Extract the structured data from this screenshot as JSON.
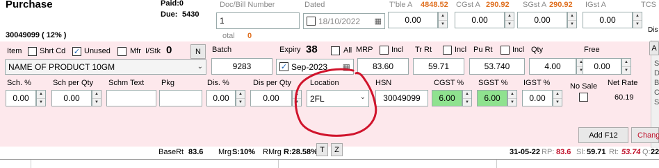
{
  "header": {
    "title": "Purchase",
    "paid_label": "Paid:0",
    "due_label": "Due:",
    "due_value": "5430",
    "invoice_ref": "30049099 ( 12% )",
    "total_label": "otal",
    "total_value": "0"
  },
  "doc": {
    "label": "Doc/Bill Number",
    "value": "1"
  },
  "dated": {
    "label": "Dated",
    "value": "18/10/2022"
  },
  "tax_summary": {
    "tble_label": "T'ble A",
    "tble_value": "4848.52",
    "cgst_label": "CGst A",
    "cgst_value": "290.92",
    "sgst_label": "SGst A",
    "sgst_value": "290.92",
    "igst_label": "IGst A",
    "igst_value": "",
    "tcs_label": "TCS",
    "field_cgst": "0.00",
    "field_sgst": "0.00",
    "field_igst": "0.00",
    "field_tble": "0.00"
  },
  "item_row": {
    "item_label": "Item",
    "shrt_cd": "Shrt Cd",
    "unused": "Unused",
    "mfr": "Mfr",
    "istk": "I/Stk",
    "istk_value": "0",
    "n_btn": "N",
    "product": "NAME OF PRODUCT 10GM",
    "batch_label": "Batch",
    "batch_value": "9283",
    "expiry_label": "Expiry",
    "expiry_count": "38",
    "all_label": "All",
    "expiry_value": "Sep-2023",
    "mrp_label": "MRP",
    "incl": "Incl",
    "mrp_value": "83.60",
    "trrt_label": "Tr Rt",
    "trrt_value": "59.71",
    "purt_label": "Pu Rt",
    "purt_value": "53.740",
    "qty_label": "Qty",
    "qty_value": "4.00",
    "free_label": "Free",
    "free_value": "0.00"
  },
  "scheme_row": {
    "sch_pct_label": "Sch. %",
    "sch_pct_value": "0.00",
    "sch_qty_label": "Sch  per Qty",
    "sch_qty_value": "0.00",
    "schm_text_label": "Schm Text",
    "pkg_label": "Pkg",
    "dis_pct_label": "Dis. %",
    "dis_pct_value": "0.00",
    "dis_qty_label": "Dis per Qty",
    "dis_qty_value": "0.00",
    "location_label": "Location",
    "location_value": "2FL",
    "hsn_label": "HSN",
    "hsn_value": "30049099",
    "cgst_label": "CGST %",
    "cgst_value": "6.00",
    "sgst_label": "SGST %",
    "sgst_value": "6.00",
    "igst_label": "IGST %",
    "igst_value": "0.00",
    "nosale_label": "No Sale",
    "netrate_label": "Net Rate",
    "netrate_value": "60.19"
  },
  "buttons": {
    "add": "Add F12",
    "change": "Chang",
    "t": "T",
    "z": "Z",
    "a": "A",
    "dis": "Dis"
  },
  "footer": {
    "basert_label": "BaseRt",
    "basert_value": "83.6",
    "mrg_label": "Mrg",
    "mrg_value": "S:10%",
    "rmrg_label": "RMrg",
    "rmrg_value": "R:28.58%",
    "date": "31-05-22",
    "rp_label": "RP:",
    "rp_value": "83.6",
    "sl_label": "Sl:",
    "sl_value": "59.71",
    "rt_label": "Rt:",
    "rt_value": "53.74",
    "q_label": "Q:",
    "q_value": "22"
  },
  "side_letters": [
    "S",
    "D",
    "B",
    "C",
    "S"
  ]
}
